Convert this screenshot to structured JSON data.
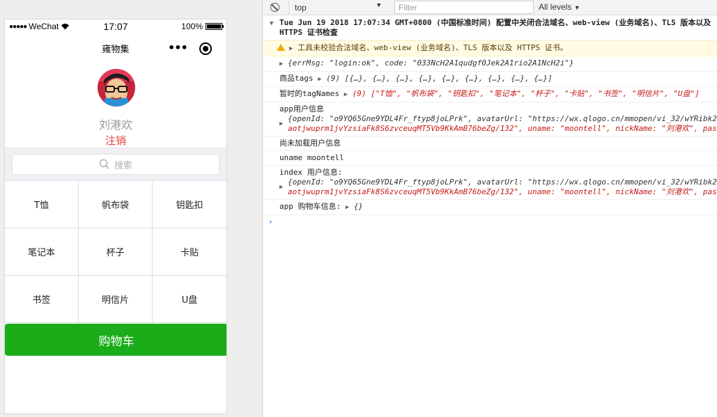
{
  "phone": {
    "status": {
      "carrier": "WeChat",
      "time": "17:07",
      "battery": "100%"
    },
    "nav_title": "雍物集",
    "nav_more": "•••",
    "profile": {
      "name": "刘港欢",
      "logout": "注销"
    },
    "search_placeholder": "搜索",
    "categories": [
      "T恤",
      "帆布袋",
      "钥匙扣",
      "笔记本",
      "杯子",
      "卡贴",
      "书签",
      "明信片",
      "U盘"
    ],
    "cart_button": "购物车"
  },
  "console": {
    "context": "top",
    "filter_placeholder": "Filter",
    "levels": "All levels",
    "rows": [
      {
        "type": "header",
        "text": "Tue Jun 19 2018 17:07:34 GMT+0800 (中国标准时间) 配置中关闭合法域名、web-view (业务域名)、TLS 版本以及 HTTPS 证书检查"
      },
      {
        "type": "warn",
        "text": "工具未校验合法域名、web-view (业务域名)、TLS 版本以及 HTTPS 证书。"
      },
      {
        "type": "obj",
        "text": "{errMsg: \"login:ok\", code: \"033NcH2A1qudgf0Jek2A1rio2A1NcH2i\"}"
      },
      {
        "type": "labeled",
        "label": "商品tags",
        "text": "(9) [{…}, {…}, {…}, {…}, {…}, {…}, {…}, {…}, {…}]"
      },
      {
        "type": "labeled",
        "label": "暂时的tagNames",
        "text": "(9) [\"T恤\", \"帆布袋\", \"钥匙扣\", \"笔记本\", \"杯子\", \"卡贴\", \"书签\", \"明信片\", \"U盘\"]"
      },
      {
        "type": "multi",
        "label": "app用户信息",
        "line1": "{openId: \"o9YQ65Gne9YDL4Fr_ftyp8joLPrk\", avatarUrl: \"https://wx.qlogo.cn/mmopen/vi_32/wYRibk2",
        "line2": "aotjwuprm1jvYzsiaFk8S6zvceuqMT5Vb9KkAmB76beZg/132\", uname: \"moontell\", nickName: \"刘港欢\", pas"
      },
      {
        "type": "plain",
        "text": "尚未加载用户信息"
      },
      {
        "type": "plain",
        "text": "uname moontell"
      },
      {
        "type": "multi",
        "label": "index 用户信息:",
        "line1": "{openId: \"o9YQ65Gne9YDL4Fr_ftyp8joLPrk\", avatarUrl: \"https://wx.qlogo.cn/mmopen/vi_32/wYRibk2",
        "line2": "aotjwuprm1jvYzsiaFk8S6zvceuqMT5Vb9KkAmB76beZg/132\", uname: \"moontell\", nickName: \"刘港欢\", pas"
      },
      {
        "type": "labeled",
        "label": "app 购物车信息:",
        "text": "{}"
      }
    ],
    "prompt": "›"
  }
}
